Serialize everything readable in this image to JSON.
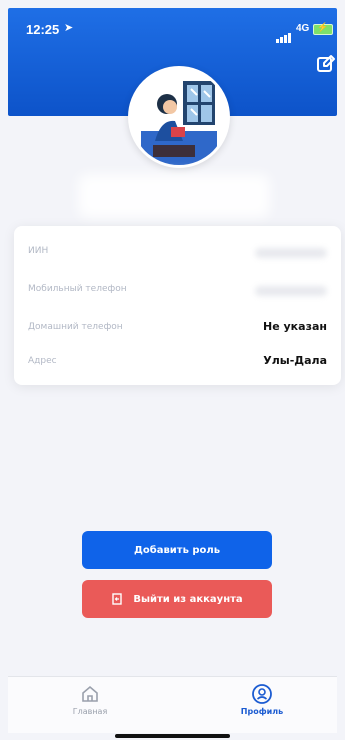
{
  "status": {
    "time": "12:25",
    "network": "4G",
    "location_icon": "location-arrow-icon",
    "signal_icon": "signal-bars-icon",
    "battery_icon": "battery-charging-icon"
  },
  "header": {
    "edit_icon": "edit-icon"
  },
  "profile": {
    "avatar_icon": "avatar-illustration-icon"
  },
  "info": {
    "rows": [
      {
        "label": "ИИН",
        "value": ""
      },
      {
        "label": "Мобильный телефон",
        "value": ""
      },
      {
        "label": "Домашний телефон",
        "value": "Не указан"
      },
      {
        "label": "Адрес",
        "value": "Улы-Дала"
      }
    ]
  },
  "actions": {
    "add_role": "Добавить роль",
    "logout": "Выйти из аккаунта"
  },
  "tabbar": {
    "home": "Главная",
    "profile": "Профиль"
  },
  "colors": {
    "primary": "#0f63e9",
    "danger": "#ea5a58",
    "header": "#0d53c9"
  }
}
